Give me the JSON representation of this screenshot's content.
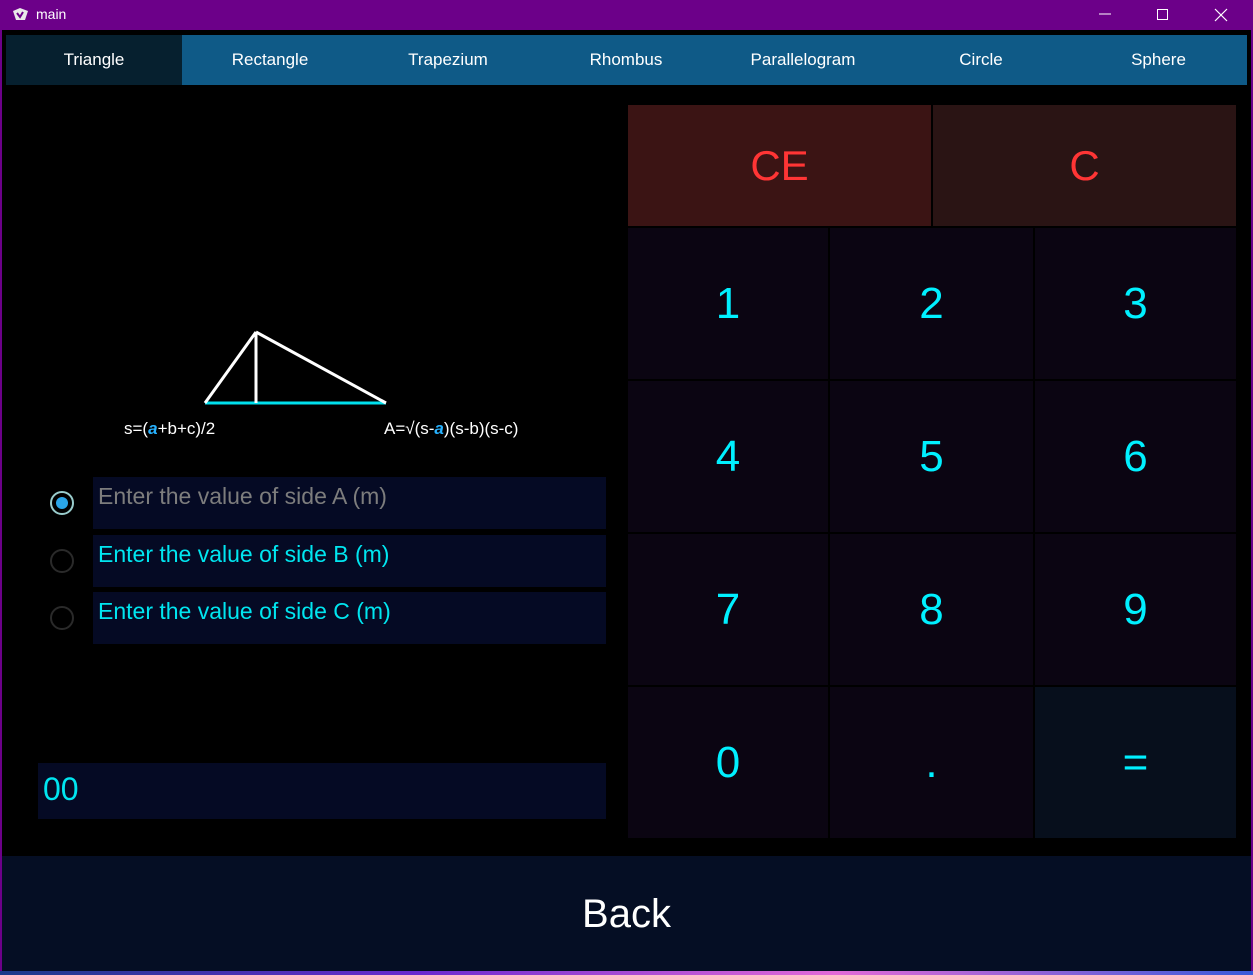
{
  "window": {
    "title": "main"
  },
  "tabs": [
    {
      "label": "Triangle",
      "active": true
    },
    {
      "label": "Rectangle",
      "active": false
    },
    {
      "label": "Trapezium",
      "active": false
    },
    {
      "label": "Rhombus",
      "active": false
    },
    {
      "label": "Parallelogram",
      "active": false
    },
    {
      "label": "Circle",
      "active": false
    },
    {
      "label": "Sphere",
      "active": false
    }
  ],
  "formulas": {
    "s_prefix": "s=(",
    "s_highlight": "a",
    "s_suffix": "+b+c)/2",
    "a_prefix": "A=√(s-",
    "a_highlight": "a",
    "a_suffix": ")(s-b)(s-c)"
  },
  "inputs": [
    {
      "placeholder": "Enter the value of side A (m)",
      "selected": true
    },
    {
      "placeholder": "Enter the value of side B (m)",
      "selected": false
    },
    {
      "placeholder": "Enter the value of side C (m)",
      "selected": false
    }
  ],
  "result": "00",
  "keypad": {
    "ce": "CE",
    "c": "C",
    "k1": "1",
    "k2": "2",
    "k3": "3",
    "k4": "4",
    "k5": "5",
    "k6": "6",
    "k7": "7",
    "k8": "8",
    "k9": "9",
    "k0": "0",
    "dot": ".",
    "eq": "="
  },
  "back_label": "Back",
  "colors": {
    "titlebar": "#6c0089",
    "tab_bar": "#0f5a87",
    "tab_active": "#06202f",
    "highlight": "#27b2ff",
    "digit": "#00f0ff",
    "clear_text": "#ff3535"
  },
  "icons": {
    "app": "kivy-app-icon",
    "minimize": "minimize-icon",
    "maximize": "maximize-icon",
    "close": "close-icon"
  }
}
